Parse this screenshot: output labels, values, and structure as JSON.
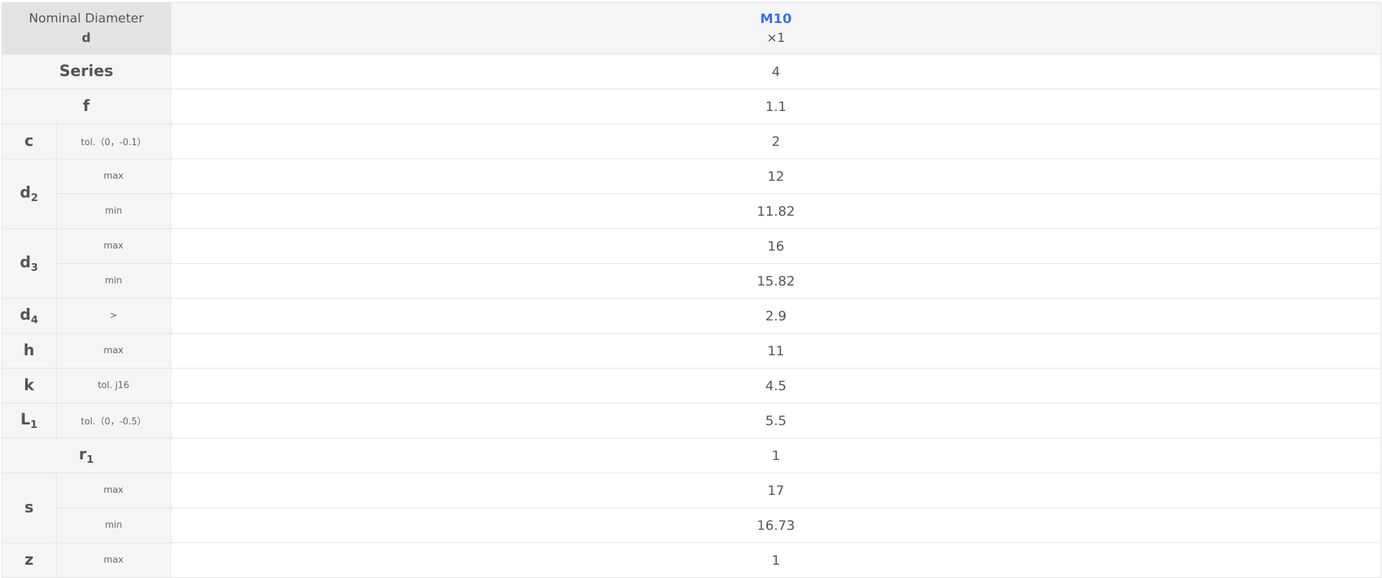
{
  "header": {
    "label_line1": "Nominal Diameter",
    "label_line2": "d",
    "size": "M10",
    "pitch": "×1"
  },
  "rows": {
    "series": {
      "label": "Series",
      "value": "4"
    },
    "f": {
      "label": "f",
      "value": "1.1"
    },
    "c": {
      "label": "c",
      "sub": "tol.（0，-0.1）",
      "value": "2"
    },
    "d2": {
      "label": "d",
      "idx": "2",
      "max_label": "max",
      "max": "12",
      "min_label": "min",
      "min": "11.82"
    },
    "d3": {
      "label": "d",
      "idx": "3",
      "max_label": "max",
      "max": "16",
      "min_label": "min",
      "min": "15.82"
    },
    "d4": {
      "label": "d",
      "idx": "4",
      "sub": ">",
      "value": "2.9"
    },
    "h": {
      "label": "h",
      "sub": "max",
      "value": "11"
    },
    "k": {
      "label": "k",
      "sub": "tol. j16",
      "value": "4.5"
    },
    "l1": {
      "label": "L",
      "idx": "1",
      "sub": "tol.（0，-0.5）",
      "value": "5.5"
    },
    "r1": {
      "label": "r",
      "idx": "1",
      "value": "1"
    },
    "s": {
      "label": "s",
      "max_label": "max",
      "max": "17",
      "min_label": "min",
      "min": "16.73"
    },
    "z": {
      "label": "z",
      "sub": "max",
      "value": "1"
    }
  }
}
